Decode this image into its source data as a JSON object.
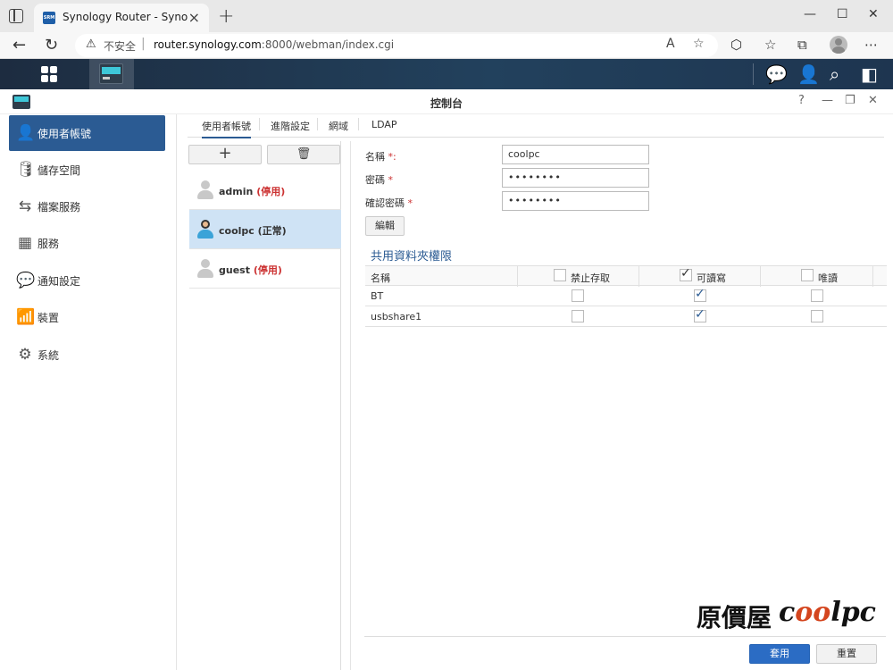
{
  "browser": {
    "tab_title": "Synology Router - SynologyRouter",
    "favicon_text": "SRM",
    "new_tab": "+",
    "not_secure": "不安全",
    "url_host": "router.synology.com",
    "url_rest": ":8000/webman/index.cgi"
  },
  "window": {
    "title": "控制台"
  },
  "sidebar": {
    "items": [
      {
        "label": "使用者帳號",
        "icon": "user-icon"
      },
      {
        "label": "儲存空間",
        "icon": "database-icon"
      },
      {
        "label": "檔案服務",
        "icon": "file-services-icon"
      },
      {
        "label": "服務",
        "icon": "grid-icon"
      },
      {
        "label": "通知設定",
        "icon": "chat-icon"
      },
      {
        "label": "裝置",
        "icon": "router-icon"
      },
      {
        "label": "系統",
        "icon": "gear-icon"
      }
    ]
  },
  "tabs": [
    "使用者帳號",
    "進階設定",
    "網域",
    "LDAP"
  ],
  "users": [
    {
      "name": "admin",
      "status": "(停用)"
    },
    {
      "name": "coolpc",
      "status": "(正常)"
    },
    {
      "name": "guest",
      "status": "(停用)"
    }
  ],
  "form": {
    "name_label": "名稱",
    "name_req": "*:",
    "name_value": "coolpc",
    "password_label": "密碼",
    "password_req": "*",
    "password_value": "••••••••",
    "confirm_label": "確認密碼",
    "confirm_req": "*",
    "confirm_value": "••••••••",
    "edit_button": "編輯",
    "section_title": "共用資料夾權限"
  },
  "permissions": {
    "headers": [
      "名稱",
      "禁止存取",
      "可讀寫",
      "唯讀"
    ],
    "header_checked": [
      false,
      true,
      false
    ],
    "rows": [
      {
        "name": "BT",
        "deny": false,
        "rw": true,
        "ro": false
      },
      {
        "name": "usbshare1",
        "deny": false,
        "rw": true,
        "ro": false
      }
    ]
  },
  "footer": {
    "apply": "套用",
    "reset": "重置"
  },
  "watermark": {
    "cn": "原價屋",
    "en_c": "c",
    "en_oo": "oo",
    "en_lpc": "lpc"
  }
}
